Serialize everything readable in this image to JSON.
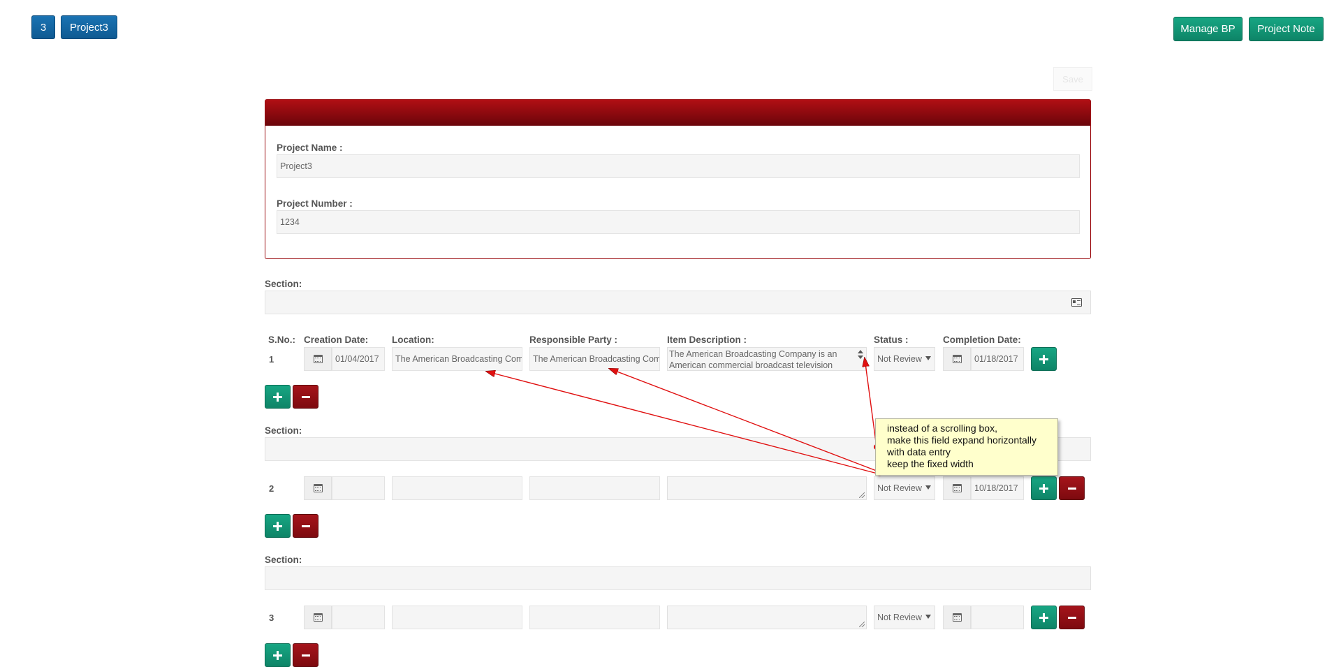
{
  "header": {
    "left_buttons": [
      "3",
      "Project3"
    ],
    "right_buttons": [
      "Manage BP",
      "Project Note"
    ]
  },
  "save_label": "Save",
  "project": {
    "name_label": "Project Name :",
    "name_value": "Project3",
    "number_label": "Project Number :",
    "number_value": "1234"
  },
  "section_label": "Section:",
  "columns": [
    "S.No.:",
    "Creation Date:",
    "Location:",
    "Responsible Party :",
    "Item Description :",
    "Status :",
    "Completion Date:"
  ],
  "rows": [
    {
      "sno": "1",
      "creation_date": "01/04/2017",
      "location": "The American Broadcasting Com",
      "responsible_party": "The American Broadcasting Com",
      "item_description": "The American Broadcasting Company is an American commercial broadcast television",
      "status": "Not Review",
      "completion_date": "01/18/2017"
    },
    {
      "sno": "2",
      "creation_date": "",
      "location": "",
      "responsible_party": "",
      "item_description": "",
      "status": "Not Review",
      "completion_date": "10/18/2017"
    },
    {
      "sno": "3",
      "creation_date": "",
      "location": "",
      "responsible_party": "",
      "item_description": "",
      "status": "Not Review",
      "completion_date": ""
    }
  ],
  "annotation": {
    "lines": [
      "instead of a scrolling box,",
      "make this field expand horizontally",
      "with data entry",
      "keep the fixed width"
    ]
  },
  "colors": {
    "primary_blue": "#0f5a92",
    "teal": "#0e8467",
    "dark_red": "#7d0a0f",
    "annotation_bg": "#ffffcc",
    "arrow_red": "#e01010"
  }
}
